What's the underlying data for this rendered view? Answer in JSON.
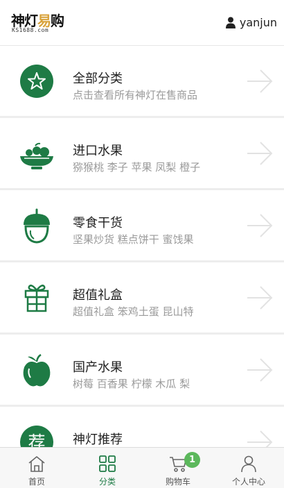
{
  "header": {
    "logo_main": "神灯易购",
    "logo_main_a": "神灯",
    "logo_main_b": "易",
    "logo_main_c": "购",
    "logo_sub": "KS1688.com",
    "user_icon": "user-icon",
    "username": "yanjun"
  },
  "colors": {
    "brand_green": "#1e7b45",
    "badge_green": "#5cb85c",
    "logo_gold": "#d8a23a"
  },
  "categories": [
    {
      "title": "全部分类",
      "subtitle": "点击查看所有神灯在售商品",
      "icon": "star-circle-icon"
    },
    {
      "title": "进口水果",
      "subtitle": "猕猴桃 李子 苹果 凤梨 橙子",
      "icon": "fruit-bowl-icon"
    },
    {
      "title": "零食干货",
      "subtitle": "坚果炒货 糕点饼干 蜜饯果",
      "icon": "acorn-icon"
    },
    {
      "title": "超值礼盒",
      "subtitle": "超值礼盒 笨鸡土蛋 昆山特",
      "icon": "gift-icon"
    },
    {
      "title": "国产水果",
      "subtitle": "树莓 百香果 柠檬 木瓜 梨",
      "icon": "apple-icon"
    },
    {
      "title": "神灯推荐",
      "subtitle": "",
      "icon": "recommend-icon",
      "icon_text": "荐"
    }
  ],
  "tabbar": {
    "tabs": [
      {
        "label": "首页",
        "icon": "home-icon"
      },
      {
        "label": "分类",
        "icon": "grid-icon",
        "active": true
      },
      {
        "label": "购物车",
        "icon": "cart-icon",
        "badge": "1"
      },
      {
        "label": "个人中心",
        "icon": "person-icon"
      }
    ]
  }
}
